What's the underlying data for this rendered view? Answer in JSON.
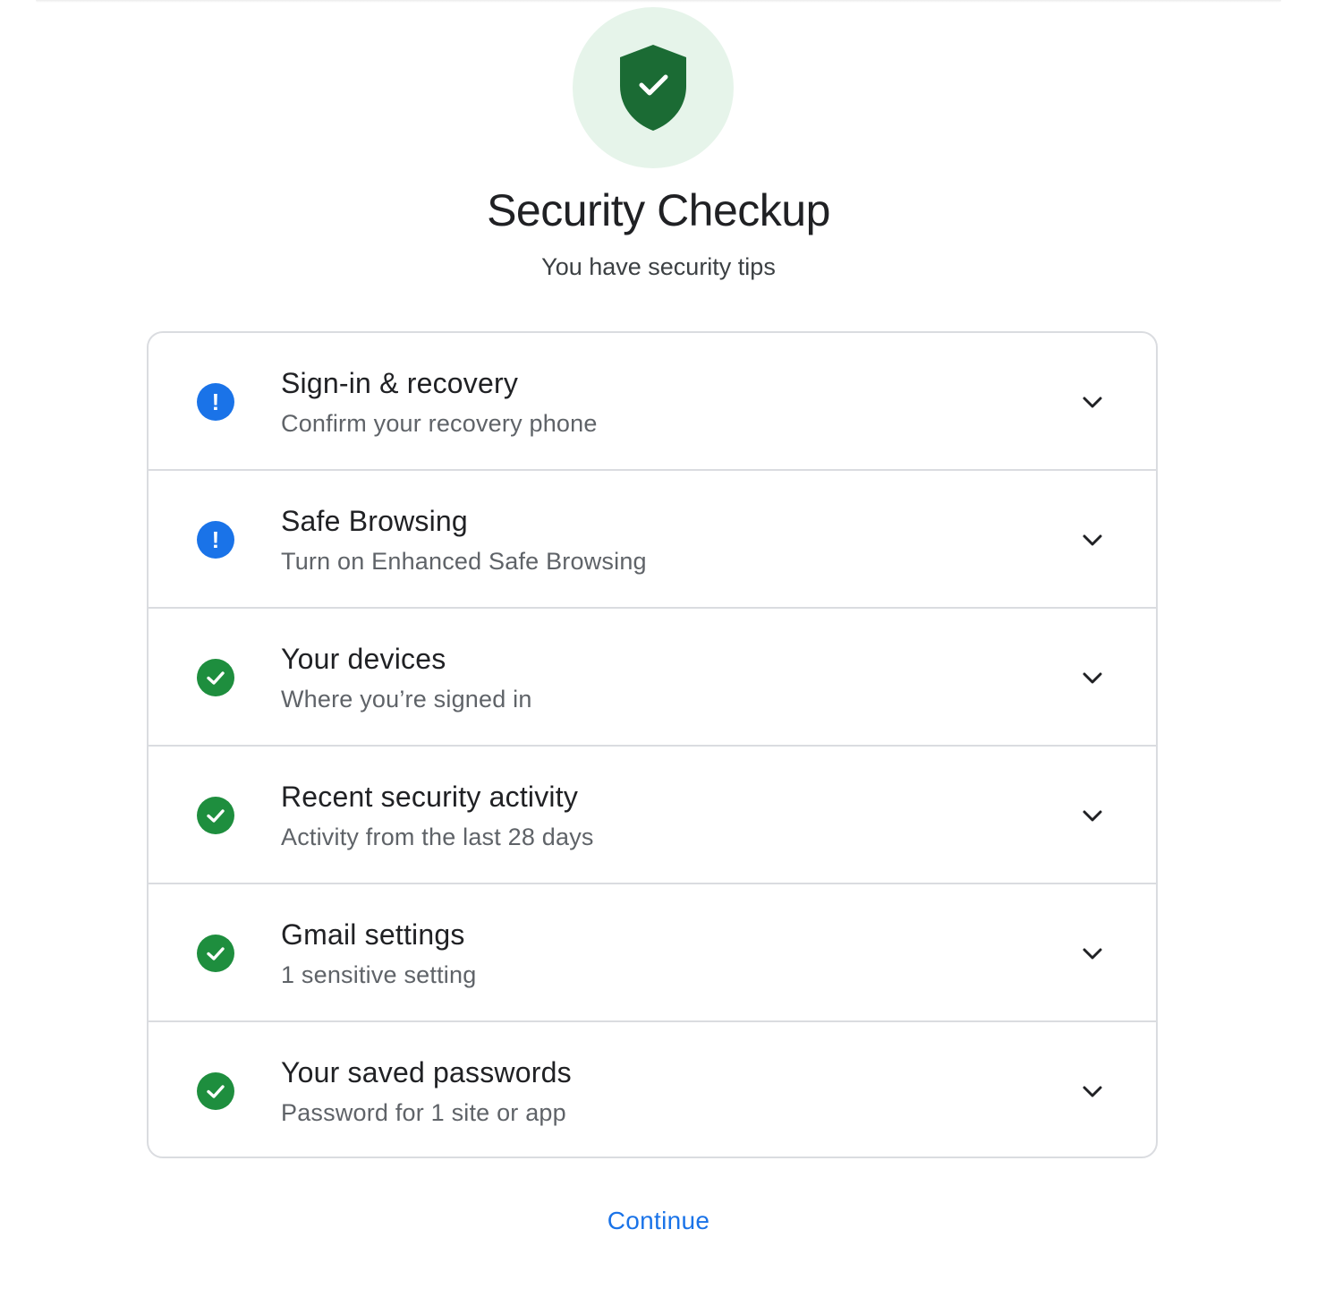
{
  "header": {
    "title": "Security Checkup",
    "subtitle": "You have security tips",
    "hero_icon": "shield-check-icon"
  },
  "colors": {
    "accent": "#1a73e8",
    "ok": "#1e8e3e",
    "shield": "#1b6b34",
    "hero_bg": "#e6f4ea"
  },
  "items": [
    {
      "title": "Sign-in & recovery",
      "description": "Confirm your recovery phone",
      "status": "warning",
      "status_icon": "exclamation-icon"
    },
    {
      "title": "Safe Browsing",
      "description": "Turn on Enhanced Safe Browsing",
      "status": "warning",
      "status_icon": "exclamation-icon"
    },
    {
      "title": "Your devices",
      "description": "Where you’re signed in",
      "status": "ok",
      "status_icon": "check-circle-icon"
    },
    {
      "title": "Recent security activity",
      "description": "Activity from the last 28 days",
      "status": "ok",
      "status_icon": "check-circle-icon"
    },
    {
      "title": "Gmail settings",
      "description": "1 sensitive setting",
      "status": "ok",
      "status_icon": "check-circle-icon"
    },
    {
      "title": "Your saved passwords",
      "description": "Password for 1 site or app",
      "status": "ok",
      "status_icon": "check-circle-icon"
    }
  ],
  "footer": {
    "continue_label": "Continue"
  }
}
